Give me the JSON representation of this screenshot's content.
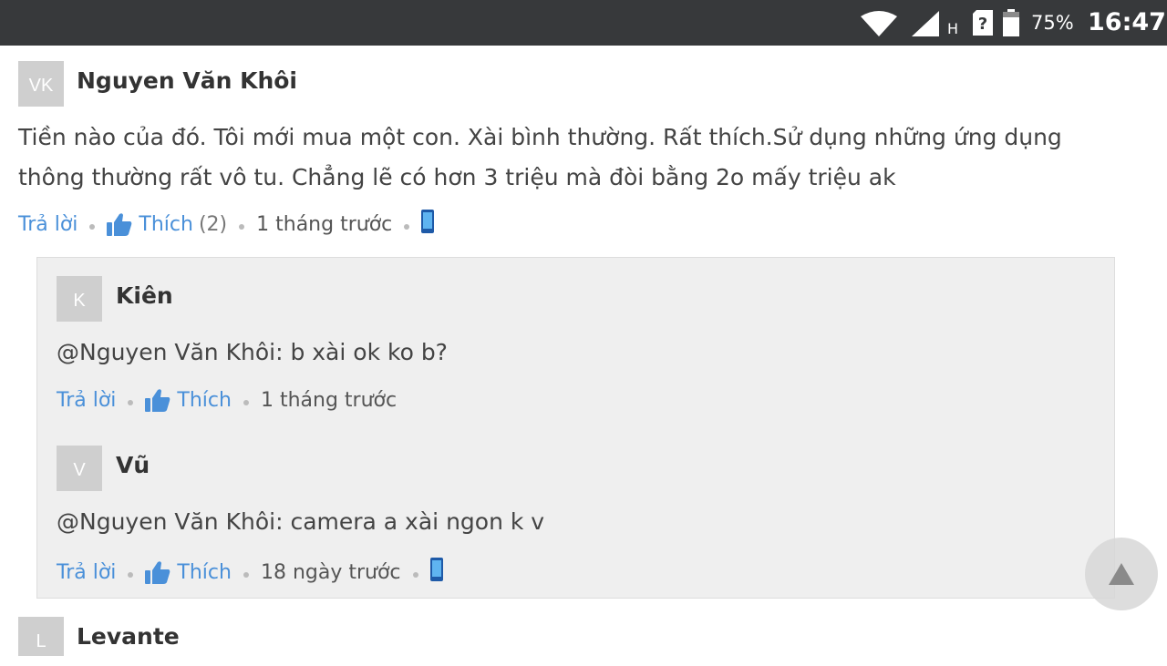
{
  "status_bar": {
    "network_type": "H",
    "battery_percent": "75%",
    "time": "16:47",
    "icons": [
      "wifi-icon",
      "signal-icon",
      "sim-unknown-icon",
      "battery-icon"
    ]
  },
  "comments": [
    {
      "avatar_initials": "VK",
      "author": "Nguyen Văn Khôi",
      "text_line1": "Tiền nào của đó. Tôi mới mua một con. Xài bình thường. Rất thích.Sử dụng những ứng dụng",
      "text_line2": "thông thường rất vô tu. Chẳng lẽ có hơn 3 triệu mà đòi bằng 2o mấy triệu ak",
      "reply_label": "Trả lời",
      "like_label": "Thích",
      "like_count": "(2)",
      "time_ago": "1 tháng trước",
      "device_icon": "phone-icon",
      "replies": [
        {
          "avatar_initials": "K",
          "author": "Kiên",
          "text": "@Nguyen Văn Khôi: b xài ok ko b?",
          "reply_label": "Trả lời",
          "like_label": "Thích",
          "time_ago": "1 tháng trước"
        },
        {
          "avatar_initials": "V",
          "author": "Vũ",
          "text": "@Nguyen Văn Khôi: camera a xài ngon k v",
          "reply_label": "Trả lời",
          "like_label": "Thích",
          "time_ago": "18 ngày trước",
          "device_icon": "phone-icon"
        }
      ]
    },
    {
      "avatar_initials": "L",
      "author": "Levante"
    }
  ],
  "colors": {
    "link": "#4a90d9",
    "status_bar": "#37393b",
    "reply_background": "#efefef"
  }
}
